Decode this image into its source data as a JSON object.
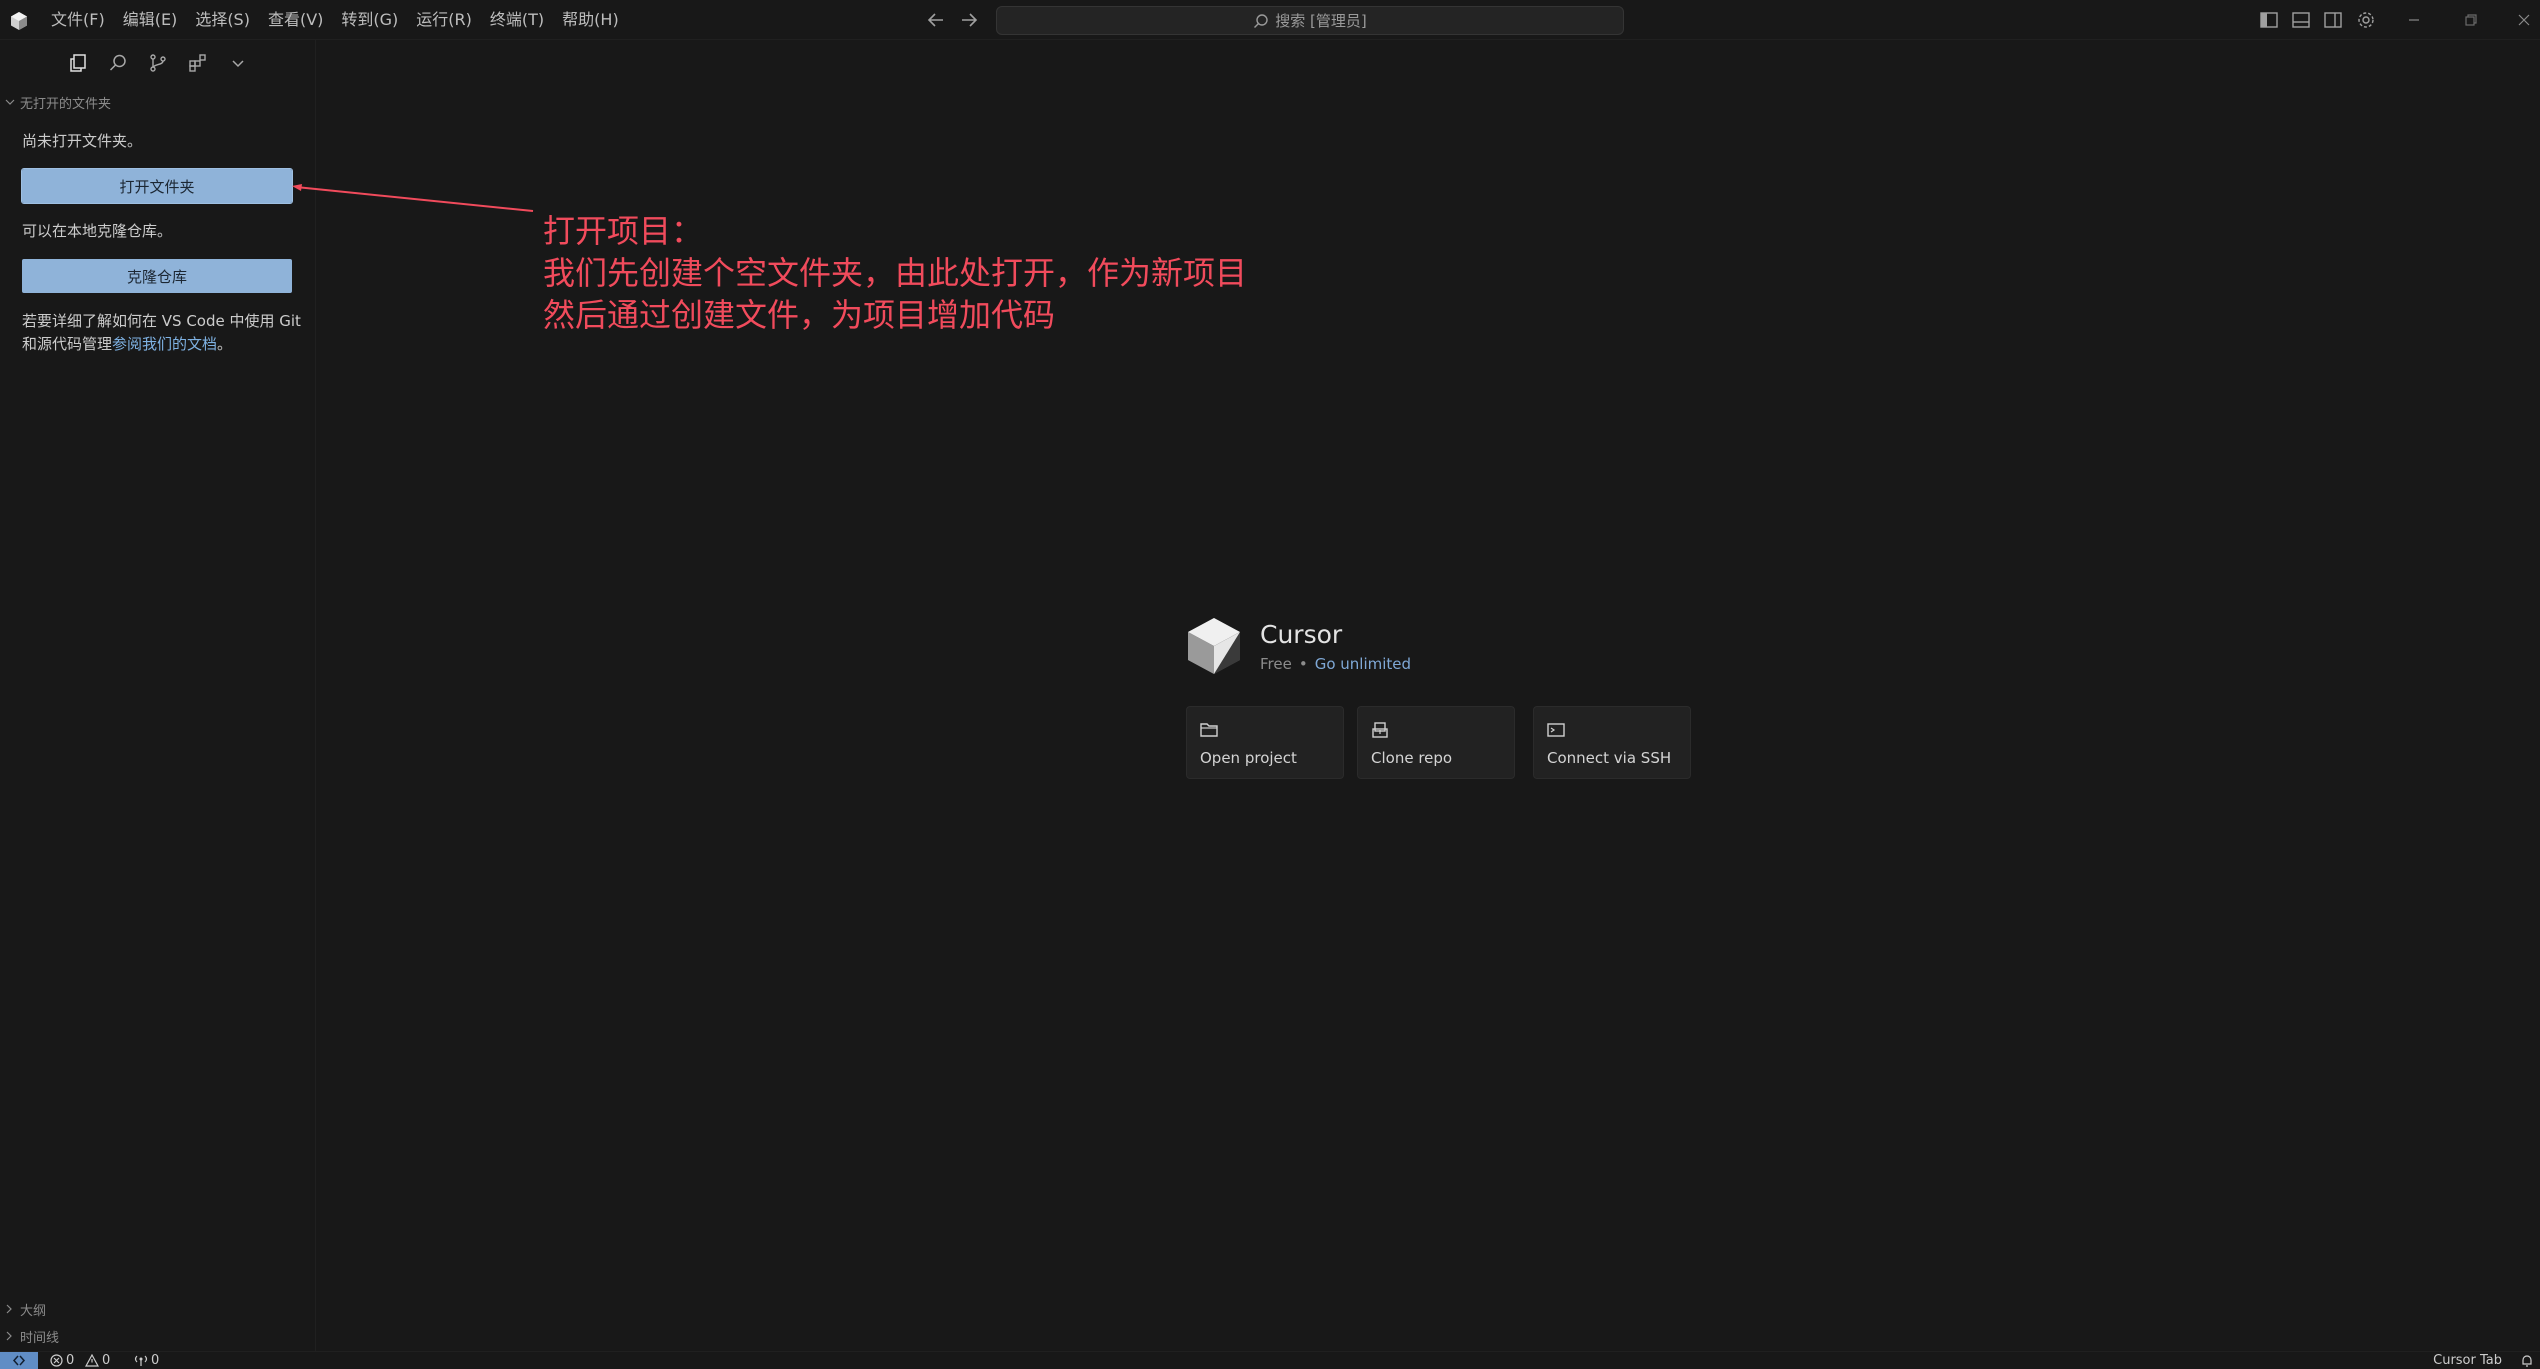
{
  "menu": {
    "file": "文件(F)",
    "edit": "编辑(E)",
    "selection": "选择(S)",
    "view": "查看(V)",
    "go": "转到(G)",
    "run": "运行(R)",
    "terminal": "终端(T)",
    "help": "帮助(H)"
  },
  "search": {
    "placeholder": "搜索 [管理员]"
  },
  "sidebar": {
    "header": "无打开的文件夹",
    "no_folder_text": "尚未打开文件夹。",
    "open_folder_label": "打开文件夹",
    "clone_hint": "可以在本地克隆仓库。",
    "clone_repo_label": "克隆仓库",
    "docs_prefix": "若要详细了解如何在 VS Code 中使用 Git 和源代码管理",
    "docs_link": "参阅我们的文档",
    "docs_suffix": "。",
    "outline_label": "大纲",
    "timeline_label": "时间线"
  },
  "annotation": {
    "line1": "打开项目：",
    "line2": "我们先创建个空文件夹，由此处打开，作为新项目",
    "line3": "然后通过创建文件，为项目增加代码",
    "color": "#f14b5c"
  },
  "welcome": {
    "app_name": "Cursor",
    "plan": "Free",
    "separator": "•",
    "upgrade_link": "Go unlimited",
    "cards": {
      "open_project": "Open project",
      "clone_repo": "Clone repo",
      "connect_ssh": "Connect via SSH"
    }
  },
  "statusbar": {
    "errors": "0",
    "warnings": "0",
    "ports": "0",
    "cursor_tab": "Cursor Tab"
  },
  "colors": {
    "background": "#181818",
    "button_bg": "#8fb3d9",
    "link": "#7fb2e3",
    "remote_accent": "#78b5ff"
  }
}
